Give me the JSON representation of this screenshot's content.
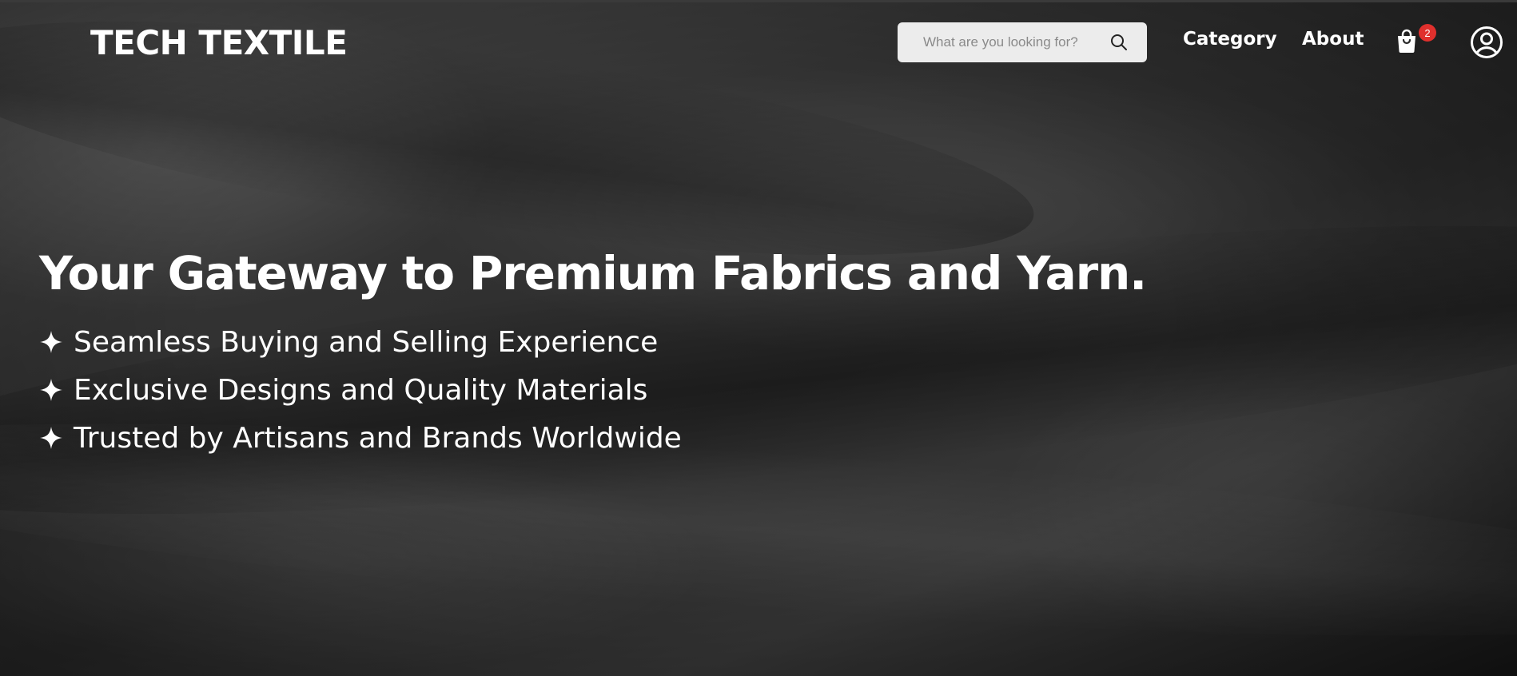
{
  "header": {
    "logo": "TECH TEXTILE",
    "search": {
      "placeholder": "What are you looking for?",
      "icon": "search-icon"
    },
    "nav": [
      {
        "label": "Category"
      },
      {
        "label": "About"
      }
    ],
    "cart": {
      "icon": "shopping-bag-icon",
      "badge_count": "2",
      "badge_color": "#e0302d"
    },
    "account": {
      "icon": "user-circle-icon"
    }
  },
  "hero": {
    "headline": "Your Gateway to Premium Fabrics and Yarn.",
    "features": [
      {
        "icon": "sparkle-icon",
        "text": "Seamless Buying and Selling Experience"
      },
      {
        "icon": "sparkle-icon",
        "text": "Exclusive Designs and Quality Materials"
      },
      {
        "icon": "sparkle-icon",
        "text": "Trusted by Artisans and Brands Worldwide"
      }
    ]
  },
  "colors": {
    "text": "#ffffff",
    "search_bg": "#ececec",
    "background": "#2b2b2b"
  }
}
